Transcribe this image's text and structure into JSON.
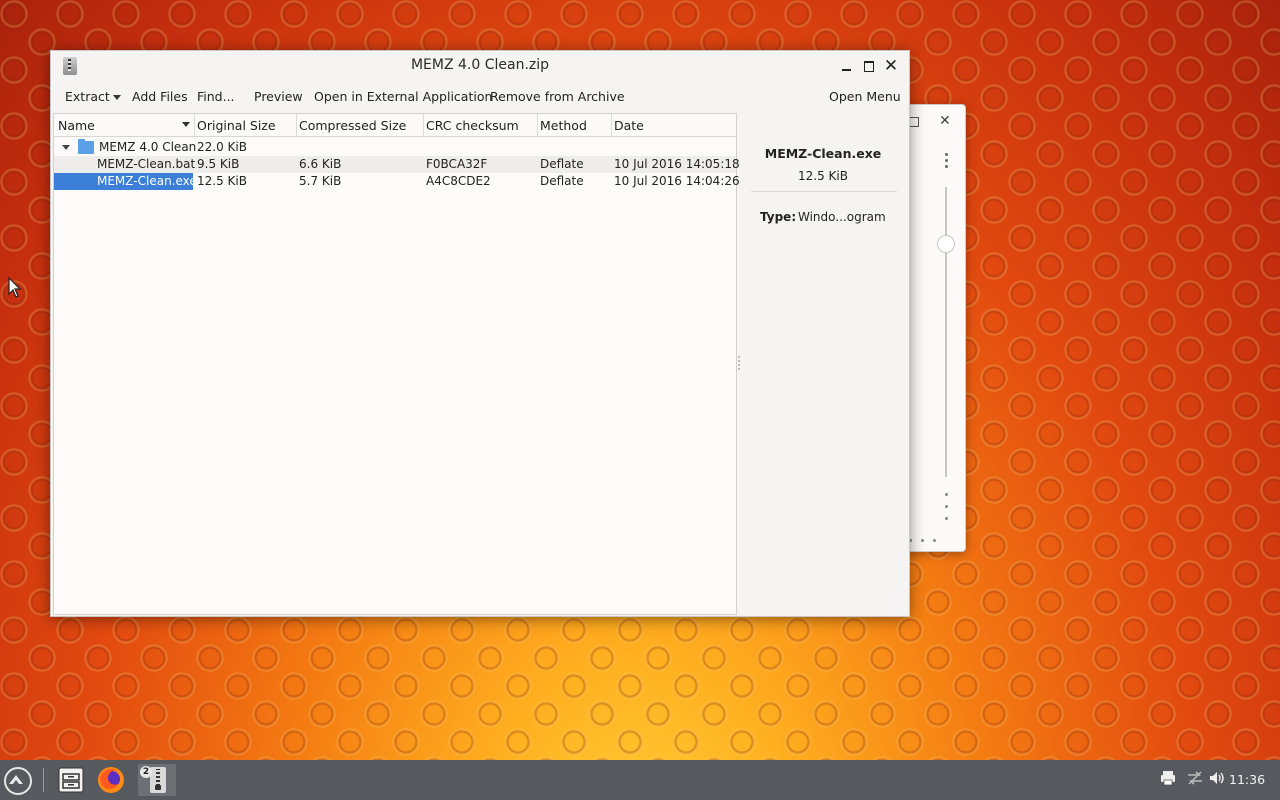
{
  "window": {
    "title": "MEMZ 4.0 Clean.zip",
    "controls": {
      "minimize": "minimize",
      "maximize": "maximize",
      "close": "✕"
    }
  },
  "toolbar": {
    "extract": "Extract",
    "add_files": "Add Files",
    "find": "Find...",
    "preview": "Preview",
    "open_external": "Open in External Application",
    "remove": "Remove from Archive",
    "open_menu": "Open Menu"
  },
  "table": {
    "columns": [
      "Name",
      "Original Size",
      "Compressed Size",
      "CRC checksum",
      "Method",
      "Date"
    ],
    "folder": {
      "name": "MEMZ 4.0 Clean",
      "size": "22.0 KiB"
    },
    "rows": [
      {
        "name": "MEMZ-Clean.bat",
        "size": "9.5 KiB",
        "compressed": "6.6 KiB",
        "crc": "F0BCA32F",
        "method": "Deflate",
        "date": "10 Jul 2016 14:05:18"
      },
      {
        "name": "MEMZ-Clean.exe",
        "size": "12.5 KiB",
        "compressed": "5.7 KiB",
        "crc": "A4C8CDE2",
        "method": "Deflate",
        "date": "10 Jul 2016 14:04:26"
      }
    ]
  },
  "info_panel": {
    "file_name": "MEMZ-Clean.exe",
    "file_size": "12.5 KiB",
    "type_label": "Type:",
    "type_value": "Windo...ogram"
  },
  "taskbar": {
    "ark_badge": "2",
    "clock": "11:36",
    "icons": [
      "start-menu-icon",
      "file-manager-icon",
      "firefox-icon",
      "ark-archive-icon",
      "printer-icon",
      "network-icon",
      "volume-icon"
    ]
  },
  "colors": {
    "selection": "#3b7fd9",
    "taskbar": "#565a5e",
    "folder": "#5aa0e6"
  }
}
